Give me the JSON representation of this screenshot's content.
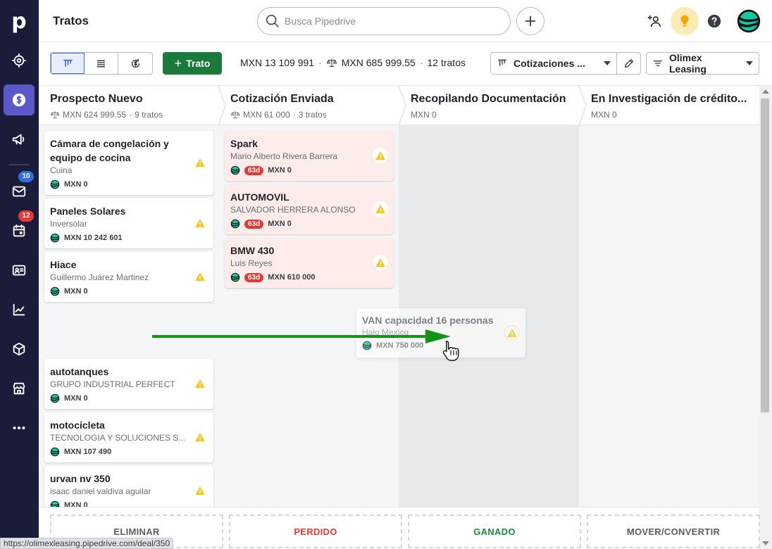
{
  "app": {
    "logo": "p",
    "title": "Tratos"
  },
  "header": {
    "search_placeholder": "Busca Pipedrive"
  },
  "rail": {
    "mail_badge": "10",
    "calendar_badge": "12"
  },
  "toolbar": {
    "add_label": "Trato",
    "total_value": "MXN 13 109 991",
    "weighted_value": "MXN 685 999.55",
    "deal_count": "12 tratos",
    "pipeline_label": "Cotizaciones ...",
    "filter_label": "Olimex Leasing"
  },
  "stages": [
    {
      "name": "Prospecto Nuevo",
      "value": "MXN 624 999.55",
      "count": "9 tratos"
    },
    {
      "name": "Cotización Enviada",
      "value": "MXN 61 000",
      "count": "3 tratos"
    },
    {
      "name": "Recopilando Documentación",
      "value": "MXN 0"
    },
    {
      "name": "En Investigación de crédito...",
      "value": "MXN 0"
    }
  ],
  "deals_stage1": [
    {
      "title": "Cámara de congelación y equipo de cocina",
      "org": "Cuina",
      "value": "MXN 0"
    },
    {
      "title": "Paneles Solares",
      "org": "Inversolar",
      "value": "MXN 10 242 601"
    },
    {
      "title": "Hiace",
      "org": "Guillermo Juárez Martinez",
      "value": "MXN 0"
    },
    {
      "title": "autotanques",
      "org": "GRUPO INDUSTRIAL PERFECT",
      "value": "MXN 0"
    },
    {
      "title": "motocicleta",
      "org": "TECNOLOGIA Y SOLUCIONES S...",
      "value": "MXN 107 490"
    },
    {
      "title": "urvan nv 350",
      "org": "isaac daniel valdiva aguilar",
      "value": "MXN 0"
    }
  ],
  "deals_stage2": [
    {
      "title": "Spark",
      "org": "Mario Alberto Rivera Barrera",
      "age": "63d",
      "value": "MXN 0"
    },
    {
      "title": "AUTOMOVIL",
      "org": "SALVADOR HERRERA ALONSO",
      "age": "63d",
      "value": "MXN 0"
    },
    {
      "title": "BMW 430",
      "org": "Luis Reyes",
      "age": "63d",
      "value": "MXN 610 000"
    }
  ],
  "dragging_deal": {
    "title": "VAN capacidad 16 personas",
    "org": "Halo Mexico",
    "value": "MXN 750 000"
  },
  "dropzones": {
    "delete": "ELIMINAR",
    "lost": "PERDIDO",
    "won": "GANADO",
    "move": "MOVER/CONVERTIR"
  },
  "status_url": "https://olimexleasing.pipedrive.com/deal/350",
  "colors": {
    "rail": "#1b1c3a",
    "rail_active": "#5b58c9",
    "primary_green": "#1a7a3c",
    "lost_red": "#e53935",
    "won_green": "#1a8a3c",
    "rotten_bg": "#fdecea",
    "warning": "#f5c518",
    "annotation_arrow": "#149414"
  },
  "icons": {
    "search": "search-icon",
    "add": "plus-icon",
    "warning": "warning-icon",
    "cursor": "hand-cursor-icon"
  }
}
